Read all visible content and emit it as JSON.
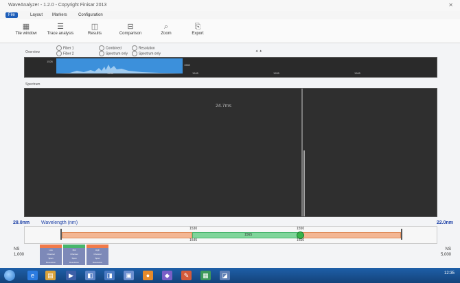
{
  "window": {
    "title": "WaveAnalyzer - 1.2.0 - Copyright Finisar 2013",
    "close": "✕"
  },
  "menu_tabs": [
    "File",
    "Layout",
    "Markers",
    "Configuration"
  ],
  "ribbon_buttons": [
    {
      "label": "Tile window",
      "icon": "grid-icon"
    },
    {
      "label": "Trace analysis",
      "icon": "table-icon"
    },
    {
      "label": "Results",
      "icon": "chart-icon"
    },
    {
      "label": "Comparison",
      "icon": "compare-icon"
    },
    {
      "label": "Zoom",
      "icon": "magnifier-icon"
    },
    {
      "label": "Export",
      "icon": "export-icon"
    }
  ],
  "options": {
    "left": [
      "Fiber 1",
      "Fiber 2"
    ],
    "mid": [
      "Combined",
      "Spectrum only"
    ],
    "right": [
      "Resolution",
      "Spectrum only"
    ],
    "badge": "✦ ✦"
  },
  "overview": {
    "label": "Overview",
    "ticks": [
      "1535",
      "1545",
      "1555",
      "1565"
    ],
    "sel_left": "1526",
    "sel_right": "1560"
  },
  "spectrum": {
    "label": "Spectrum",
    "hover_value": "24.7ms"
  },
  "wavelength": {
    "left": "28.0nm",
    "right": "22.0nm",
    "title": "Wavelength (nm)",
    "band_labels": [
      "1530",
      "1545",
      "1550",
      "1560",
      "1565"
    ]
  },
  "legend": {
    "headers": [
      "#f07a4a",
      "#47b56c",
      "#f07a4a"
    ],
    "rows": [
      [
        "Low",
        "Mid",
        "High"
      ],
      [
        "Channel",
        "Channel",
        "Channel"
      ],
      [
        "Span",
        "Span",
        "Span"
      ],
      [
        "Resolution",
        "Resolution",
        "Resolution"
      ]
    ]
  },
  "footer": {
    "left_top": "NS",
    "left_bottom": "1,000",
    "right_top": "NS",
    "right_bottom": "5,000"
  },
  "taskbar": {
    "icons": [
      "ie-icon",
      "folder-icon",
      "media-icon",
      "app-icon",
      "app-icon",
      "app-icon",
      "app-icon",
      "app-icon",
      "paint-icon",
      "app-icon",
      "app-icon"
    ],
    "time": "12:35"
  }
}
